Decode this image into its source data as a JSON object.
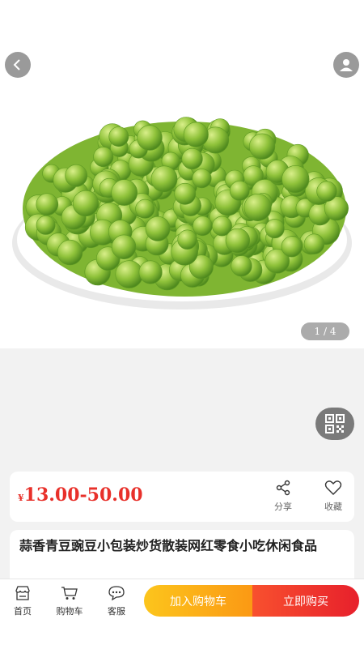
{
  "gallery": {
    "counter": "1 / 4",
    "current": 1,
    "total": 4,
    "image_subject": "green peas snack"
  },
  "icons": {
    "back": "chevron-left-icon",
    "user": "user-icon",
    "qr": "qr-code-icon",
    "share": "share-icon",
    "favorite": "heart-icon",
    "home": "store-icon",
    "cart": "cart-icon",
    "service": "chat-icon"
  },
  "product": {
    "currency": "¥",
    "price_range": "13.00-50.00",
    "title": "蒜香青豆豌豆小包装炒货散装网红零食小吃休闲食品"
  },
  "actions": {
    "share_label": "分享",
    "favorite_label": "收藏"
  },
  "bottom_bar": {
    "home_label": "首页",
    "cart_label": "购物车",
    "service_label": "客服",
    "add_to_cart_label": "加入购物车",
    "buy_now_label": "立即购买"
  },
  "colors": {
    "price": "#e8302a",
    "add_to_cart_gradient": [
      "#fcc51c",
      "#fb9914"
    ],
    "buy_now_gradient": [
      "#f8502e",
      "#e7202c"
    ],
    "page_bg": "#f2f2f2"
  }
}
